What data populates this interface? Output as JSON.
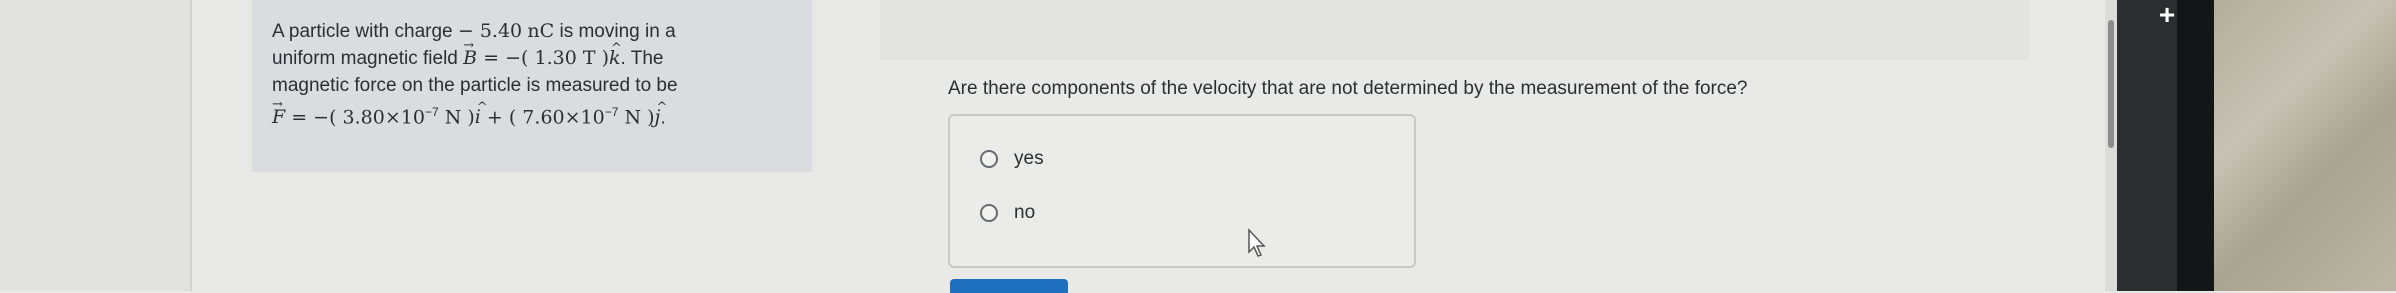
{
  "problem": {
    "line1_a": "A particle with charge ",
    "charge_value": "− 5.40",
    "charge_unit": "nC",
    "line1_b": " is moving in a",
    "line2_a": "uniform magnetic field ",
    "B_symbol": "B",
    "B_eq": " = −( 1.30 ",
    "B_unit": "T",
    "B_close": " )",
    "k_symbol": "k",
    "line2_b": ". The",
    "line3": "magnetic force on the particle is measured to be",
    "F_symbol": "F",
    "F_eq": " = −( 3.80×10",
    "F_exp": "−7",
    "F_unit": " N",
    "F_close1": " )",
    "i_symbol": "i",
    "plus": " + ( 7.60×10",
    "F_exp2": "−7",
    "F_unit2": " N",
    "F_close2": " )",
    "j_symbol": "j",
    "end": "."
  },
  "question": {
    "text": "Are there components of the velocity that are not determined by the measurement of the force?"
  },
  "options": [
    {
      "label": "yes"
    },
    {
      "label": "no"
    }
  ],
  "toolbar": {
    "plus_label": "+"
  }
}
